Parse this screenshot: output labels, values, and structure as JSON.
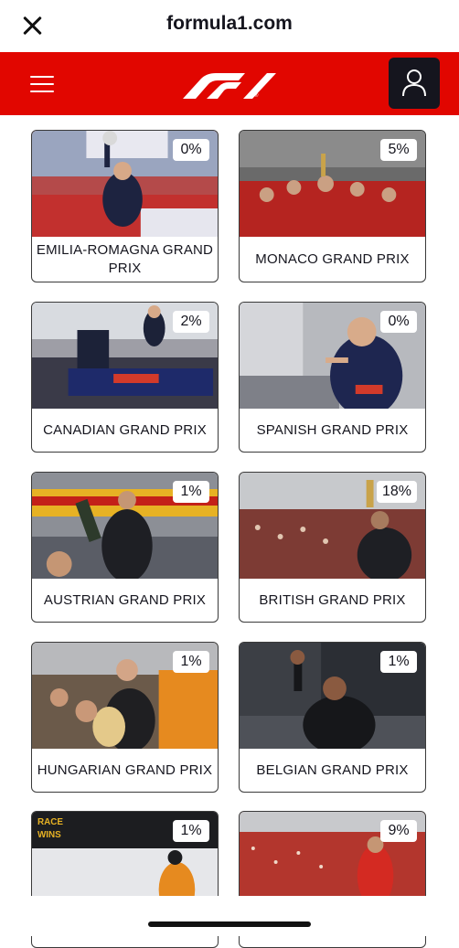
{
  "browser": {
    "site": "formula1.com"
  },
  "races": [
    {
      "name": "EMILIA-ROMAGNA GRAND PRIX",
      "pct": "0%",
      "image": "podium-trophy-photo"
    },
    {
      "name": "MONACO GRAND PRIX",
      "pct": "5%",
      "image": "team-celebration-photo"
    },
    {
      "name": "CANADIAN GRAND PRIX",
      "pct": "2%",
      "image": "car-celebration-photo"
    },
    {
      "name": "SPANISH GRAND PRIX",
      "pct": "0%",
      "image": "driver-pointing-photo"
    },
    {
      "name": "AUSTRIAN GRAND PRIX",
      "pct": "1%",
      "image": "champagne-podium-photo"
    },
    {
      "name": "BRITISH GRAND PRIX",
      "pct": "18%",
      "image": "crowd-trophy-photo"
    },
    {
      "name": "HUNGARIAN GRAND PRIX",
      "pct": "1%",
      "image": "trophy-celebration-photo"
    },
    {
      "name": "BELGIAN GRAND PRIX",
      "pct": "1%",
      "image": "fist-raise-photo"
    },
    {
      "name": "",
      "pct": "1%",
      "image": "race-wins-photo"
    },
    {
      "name": "",
      "pct": "9%",
      "image": "tifosi-crowd-photo"
    }
  ],
  "colors": {
    "brand_red": "#e10600",
    "dark": "#15151e"
  }
}
